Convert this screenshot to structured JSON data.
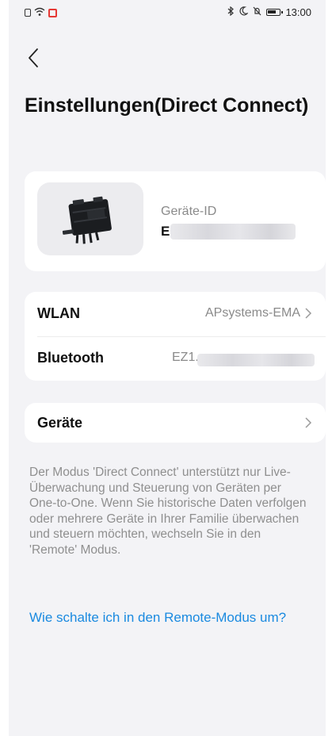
{
  "status_bar": {
    "time": "13:00",
    "left_icons": [
      "sim-icon",
      "wifi-icon",
      "notification-icon"
    ],
    "right_icons": [
      "bluetooth-icon",
      "moon-icon",
      "mute-icon",
      "battery-icon"
    ]
  },
  "header": {
    "back_icon": "chevron-left-icon",
    "title": "Einstellungen(Direct Connect)"
  },
  "device": {
    "label": "Geräte-ID",
    "value_visible": "E"
  },
  "connection": {
    "wlan_label": "WLAN",
    "wlan_value": "APsystems-EMA",
    "bluetooth_label": "Bluetooth",
    "bluetooth_value_visible": "EZ1."
  },
  "devices_row": {
    "label": "Geräte"
  },
  "info_text": "Der Modus 'Direct Connect' unterstützt nur Live-Überwachung und Steuerung von Geräten per One-to-One. Wenn Sie historische Daten verfolgen oder mehrere Geräte in Ihrer Familie überwachen und steuern möchten, wechseln Sie in den 'Remote' Modus.",
  "help_link": "Wie schalte ich in den Remote-Modus um?",
  "colors": {
    "background": "#f3f3f6",
    "card": "#ffffff",
    "link": "#1a8ae0",
    "muted_text": "#8f8f8f"
  }
}
